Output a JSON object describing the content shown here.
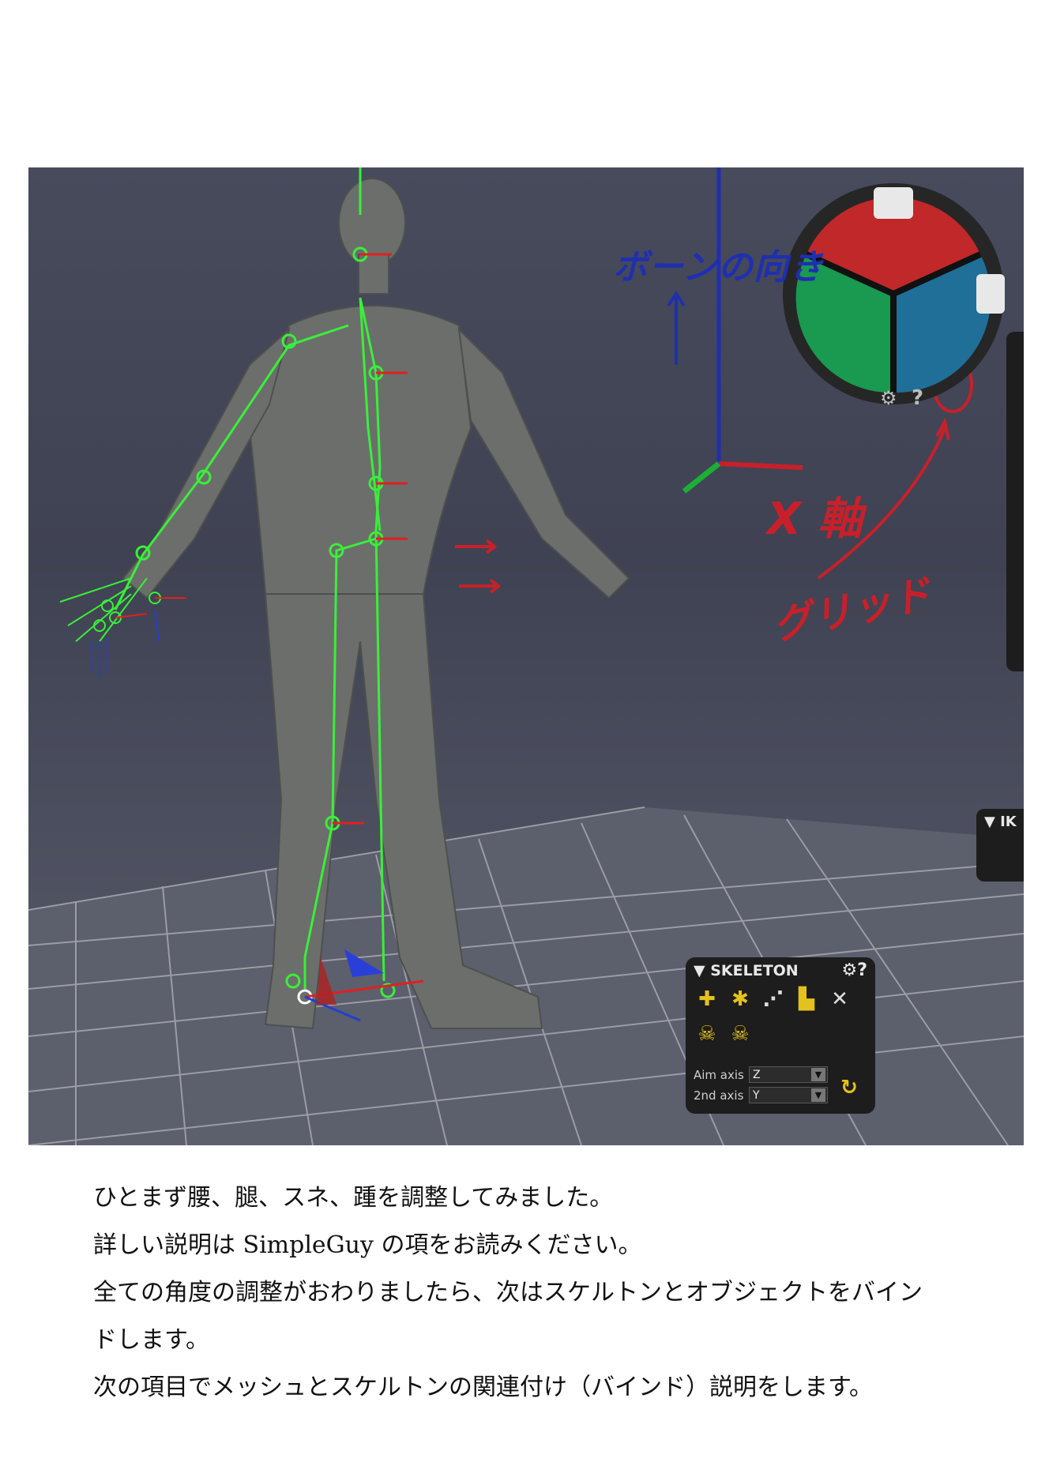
{
  "annotations": {
    "bone_direction": "ボーンの向き",
    "x_axis": "X 軸",
    "grid": "グリッド"
  },
  "skeleton_panel": {
    "title": "▼ SKELETON",
    "header_icons": "⚙?",
    "aim_axis_label": "Aim axis",
    "aim_axis_value": "Z",
    "second_axis_label": "2nd axis",
    "second_axis_value": "Y",
    "tool_icons": [
      "add-bone-icon",
      "split-bone-icon",
      "bone-chain-icon",
      "bind-icon",
      "detach-icon",
      "unity-skeleton-icon",
      "unreal-skeleton-icon",
      "grid-snap-icon"
    ]
  },
  "ik_panel": {
    "title": "▼ IK"
  },
  "gizmo": {
    "help": "?",
    "colors": {
      "x": "#c0282a",
      "y": "#1a9950",
      "z": "#1f6f99"
    }
  },
  "caption": [
    "ひとまず腰、腿、スネ、踵を調整してみました。",
    "詳しい説明は SimpleGuy の項をお読みください。",
    "全ての角度の調整がおわりましたら、次はスケルトンとオブジェクトをバイン",
    "ドします。",
    "次の項目でメッシュとスケルトンの関連付け（バインド）説明をします。"
  ]
}
